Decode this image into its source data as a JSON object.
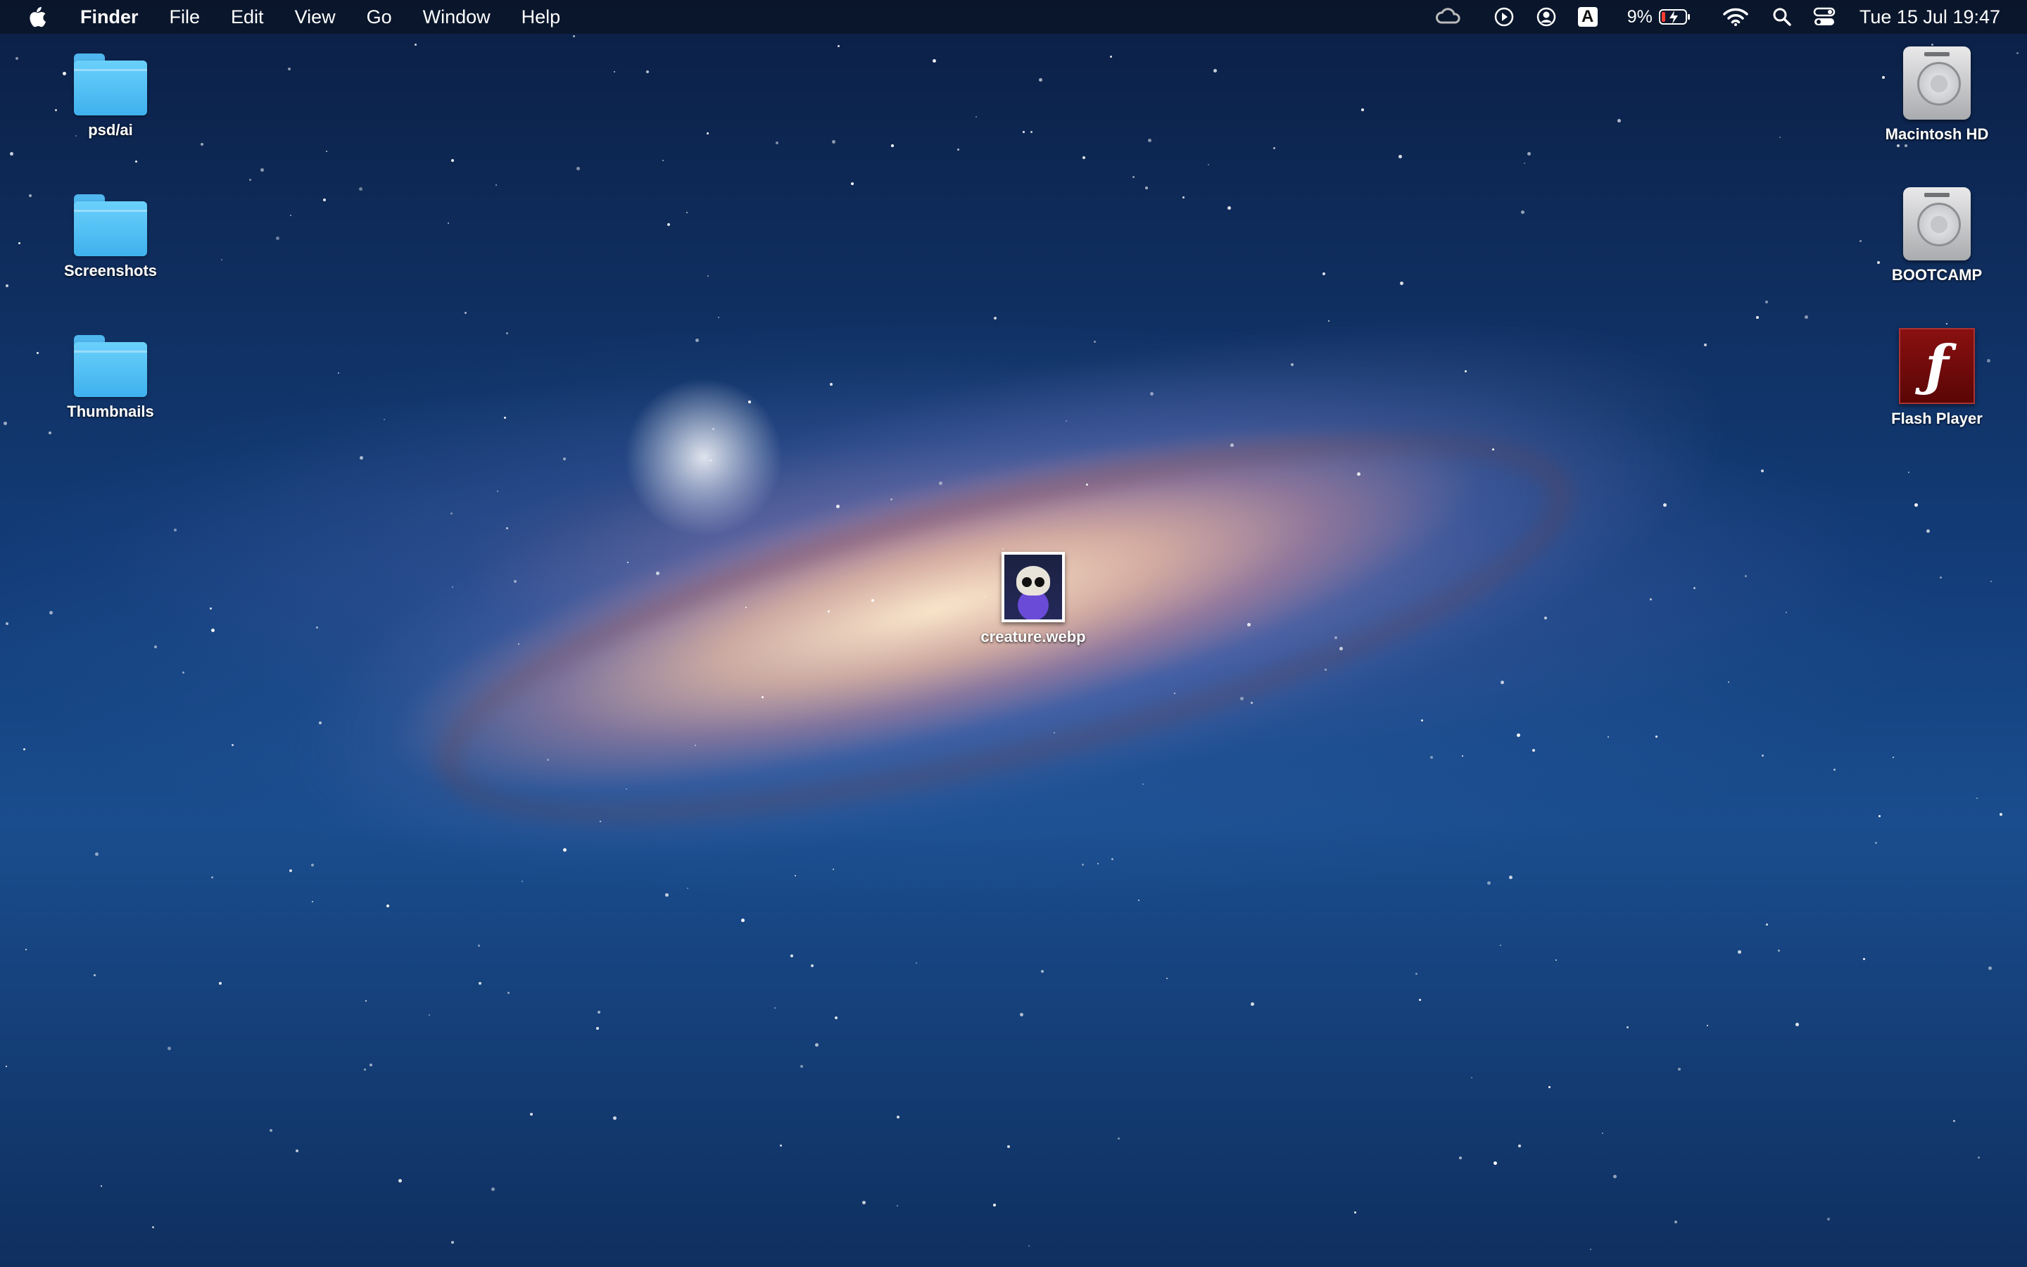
{
  "menubar": {
    "app_name": "Finder",
    "items": [
      "File",
      "Edit",
      "View",
      "Go",
      "Window",
      "Help"
    ],
    "input_source": "A",
    "battery_percent": "9%",
    "clock": "Tue 15 Jul  19:47"
  },
  "desktop_left": [
    {
      "label": "psd/ai",
      "icon": "folder-icon"
    },
    {
      "label": "Screenshots",
      "icon": "folder-icon"
    },
    {
      "label": "Thumbnails",
      "icon": "folder-icon"
    }
  ],
  "desktop_right": [
    {
      "label": "Macintosh HD",
      "icon": "hard-drive-icon"
    },
    {
      "label": "BOOTCAMP",
      "icon": "hard-drive-icon"
    },
    {
      "label": "Flash Player",
      "icon": "flash-player-icon"
    }
  ],
  "desktop_center": {
    "label": "creature.webp",
    "icon": "image-thumbnail-icon"
  },
  "colors": {
    "folder": "#4fb6ee",
    "menubar": "#0a1428",
    "flash": "#7a0c0c"
  }
}
